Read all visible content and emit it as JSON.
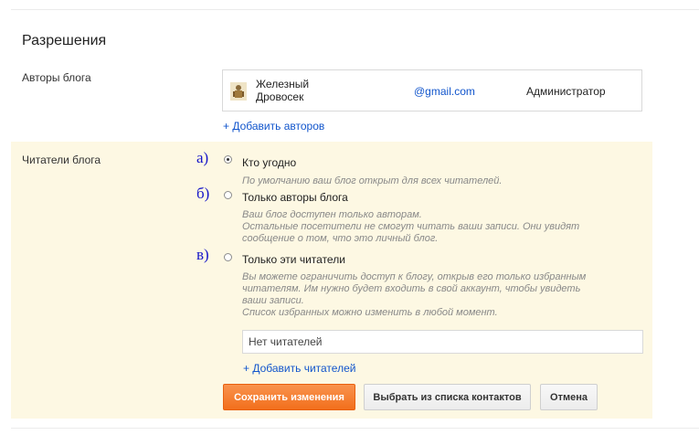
{
  "page": {
    "title": "Разрешения"
  },
  "authors": {
    "label": "Авторы блога",
    "list": [
      {
        "name": "Железный Дровосек",
        "email": "@gmail.com",
        "role": "Администратор"
      }
    ],
    "add_link": "+ Добавить авторов"
  },
  "readers": {
    "label": "Читатели блога",
    "options": [
      {
        "marker": "а)",
        "label": "Кто угодно",
        "checked": true,
        "description": [
          "По умолчанию ваш блог открыт для всех читателей."
        ]
      },
      {
        "marker": "б)",
        "label": "Только авторы блога",
        "checked": false,
        "description": [
          "Ваш блог доступен только авторам.",
          "Остальные посетители не смогут читать ваши записи. Они увидят",
          "сообщение о том, что это личный блог."
        ]
      },
      {
        "marker": "в)",
        "label": "Только эти читатели",
        "checked": false,
        "description": [
          "Вы можете ограничить доступ к блогу, открыв его только избранным",
          "читателям. Им нужно будет входить в свой аккаунт, чтобы увидеть",
          "ваши записи.",
          "Список избранных можно изменить в любой момент."
        ]
      }
    ],
    "input_placeholder": "Нет читателей",
    "add_link": "+ Добавить читателей"
  },
  "buttons": {
    "save": "Сохранить изменения",
    "choose_contacts": "Выбрать из списка контактов",
    "cancel": "Отмена"
  },
  "colors": {
    "section_bg": "#fdf8e3",
    "link": "#1155cc",
    "primary": "#f26f1c",
    "marker": "#1414c8"
  }
}
